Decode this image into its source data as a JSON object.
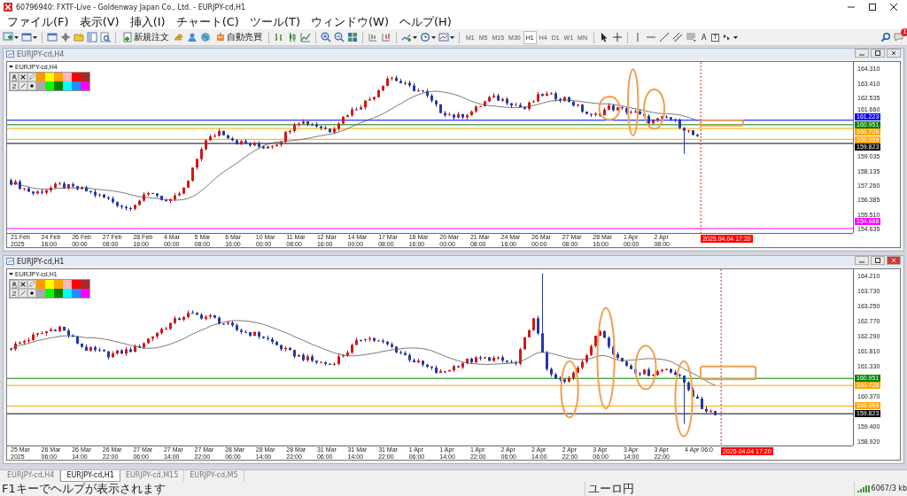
{
  "window": {
    "title": "60796940: FXTF-Live - Goldenway Japan Co., Ltd. - EURJPY-cd,H1"
  },
  "menu": [
    "ファイル(F)",
    "表示(V)",
    "挿入(I)",
    "チャート(C)",
    "ツール(T)",
    "ウィンドウ(W)",
    "ヘルプ(H)"
  ],
  "toolbar": {
    "buttons": [
      "新規注文",
      "自動売買"
    ],
    "timeframes": [
      {
        "label": "M1",
        "selected": false
      },
      {
        "label": "M5",
        "selected": false
      },
      {
        "label": "M15",
        "selected": false
      },
      {
        "label": "M30",
        "selected": false
      },
      {
        "label": "H1",
        "selected": true
      },
      {
        "label": "H4",
        "selected": false
      },
      {
        "label": "D1",
        "selected": false
      },
      {
        "label": "W1",
        "selected": false
      },
      {
        "label": "MN",
        "selected": false
      }
    ],
    "text_tool": "A",
    "label_tool": "T",
    "notification_count": "1"
  },
  "charts": [
    {
      "title": "EURJPY-cd,H4",
      "active": false,
      "symbol_label": "EURJPY-cd,H4",
      "palette_number": "2",
      "palette": [
        {
          "color": "#ff9900"
        },
        {
          "color": "#ffff00"
        },
        {
          "color": "#ffa500"
        },
        {
          "color": "#ffb6c1"
        },
        {
          "color": "#ff0000"
        },
        {
          "color": "#a52a2a"
        },
        {
          "color": "#a9a9a9"
        },
        {
          "color": "#00ff00"
        },
        {
          "color": "#008000"
        },
        {
          "color": "#00ffff"
        },
        {
          "color": "#1e90ff"
        },
        {
          "color": "#ff00ff"
        }
      ],
      "y_ticks": [
        "164.310",
        "163.410",
        "162.535",
        "161.660",
        "159.035",
        "158.135",
        "157.260",
        "156.385",
        "155.510",
        "154.635"
      ],
      "levels": [
        {
          "label": "161.223",
          "color": "#0000ff"
        },
        {
          "label": "160.951",
          "color": "#008000"
        },
        {
          "label": "160.726",
          "color": "#ffa500"
        },
        {
          "label": "160.069",
          "color": "#ffa500"
        },
        {
          "label": "159.823",
          "color": "#000000"
        },
        {
          "label": "154.688",
          "color": "#ff00ff"
        }
      ],
      "x_labels": [
        "21 Feb 2025",
        "24 Feb 16:00",
        "26 Feb 00:00",
        "27 Feb 08:00",
        "28 Feb 16:00",
        "4 Mar 00:00",
        "5 Mar 08:00",
        "6 Mar 16:00",
        "10 Mar 00:00",
        "11 Mar 08:00",
        "12 Mar 16:00",
        "14 Mar 00:00",
        "17 Mar 08:00",
        "18 Mar 16:00",
        "20 Mar 00:00",
        "21 Mar 08:00",
        "24 Mar 16:00",
        "26 Mar 00:00",
        "27 Mar 08:00",
        "28 Mar 16:00",
        "1 Apr 00:00",
        "2 Apr 08:00"
      ],
      "time_label": "2025.04.04 17:20"
    },
    {
      "title": "EURJPY-cd,H1",
      "active": true,
      "symbol_label": "EURJPY-cd,H1",
      "palette_number": "2",
      "palette": [
        {
          "color": "#ff9900"
        },
        {
          "color": "#ffff00"
        },
        {
          "color": "#ffa500"
        },
        {
          "color": "#ffb6c1"
        },
        {
          "color": "#ff0000"
        },
        {
          "color": "#a52a2a"
        },
        {
          "color": "#a9a9a9"
        },
        {
          "color": "#00ff00"
        },
        {
          "color": "#008000"
        },
        {
          "color": "#00ffff"
        },
        {
          "color": "#1e90ff"
        },
        {
          "color": "#ff00ff"
        }
      ],
      "y_ticks": [
        "164.210",
        "163.730",
        "163.250",
        "162.770",
        "162.290",
        "161.810",
        "161.330",
        "160.370",
        "159.400",
        "158.920"
      ],
      "levels": [
        {
          "label": "160.951",
          "color": "#008000"
        },
        {
          "label": "160.726",
          "color": "#ffa500"
        },
        {
          "label": "160.069",
          "color": "#ffa500"
        },
        {
          "label": "159.823",
          "color": "#000000"
        }
      ],
      "x_labels": [
        "25 Mar 2025",
        "26 Mar 06:00",
        "26 Mar 14:00",
        "26 Mar 22:00",
        "27 Mar 06:00",
        "27 Mar 14:00",
        "27 Mar 22:00",
        "28 Mar 06:00",
        "28 Mar 14:00",
        "28 Mar 22:00",
        "31 Mar 06:00",
        "31 Mar 14:00",
        "31 Mar 22:00",
        "1 Apr 06:00",
        "1 Apr 14:00",
        "1 Apr 22:00",
        "2 Apr 06:00",
        "2 Apr 14:00",
        "2 Apr 22:00",
        "3 Apr 06:00",
        "3 Apr 14:00",
        "3 Apr 22:00",
        "4 Apr 06:0"
      ],
      "time_label": "2025.04.04 17:20"
    }
  ],
  "tabs": [
    {
      "label": "EURJPY-cd,H4",
      "selected": false
    },
    {
      "label": "EURJPY-cd,H1",
      "selected": true
    },
    {
      "label": "EURJPY-cd,M15",
      "selected": false
    },
    {
      "label": "EURJPY-cd,M5",
      "selected": false
    }
  ],
  "status_bar": {
    "help": "F1キーでヘルプが表示されます",
    "symbol": "ユーロ円",
    "traffic": "6067/3 kb"
  }
}
